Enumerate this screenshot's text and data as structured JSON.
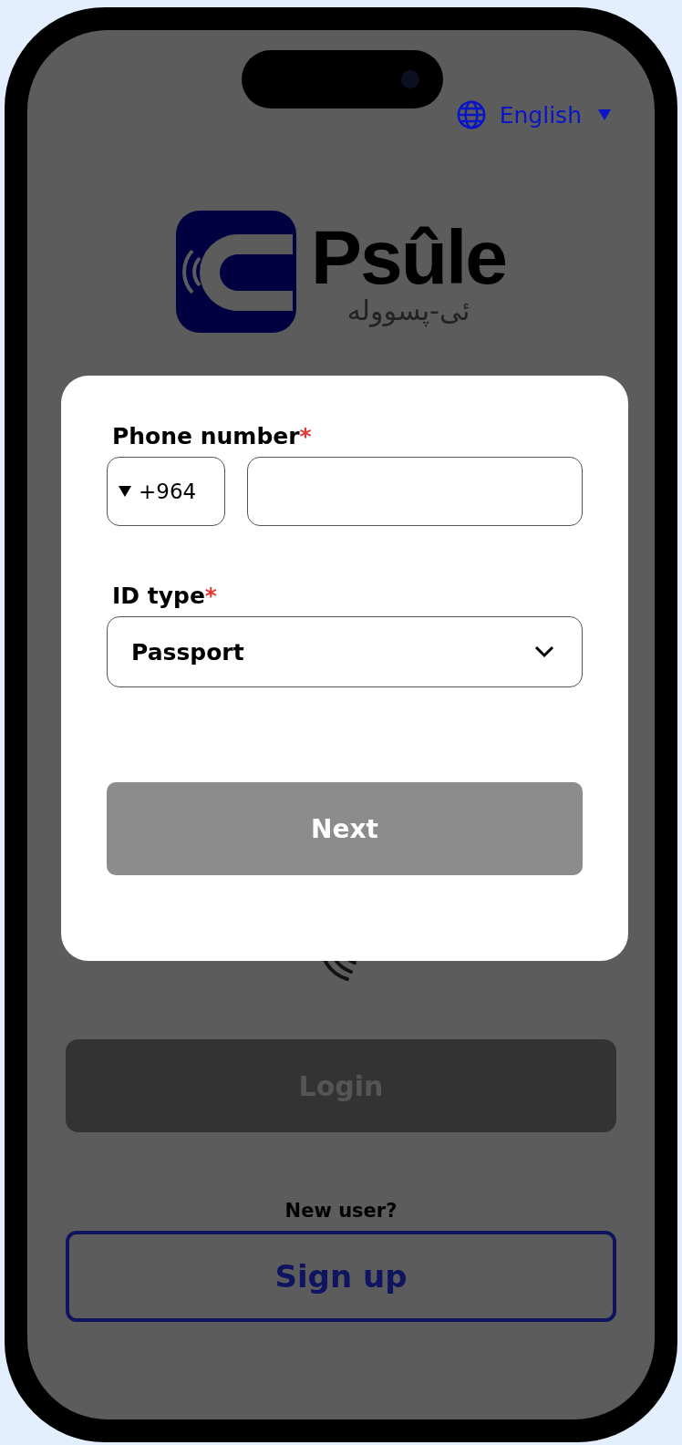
{
  "language": {
    "label": "English"
  },
  "logo": {
    "name": "Psûle",
    "subtitle": "ئی-پسوولە"
  },
  "modal": {
    "phone": {
      "label": "Phone number",
      "required_mark": "*",
      "country_code": "+964"
    },
    "id_type": {
      "label": "ID type",
      "required_mark": "*",
      "value": "Passport"
    },
    "next_button": {
      "label": "Next",
      "disabled": true
    }
  },
  "background": {
    "login_button": {
      "label": "Login",
      "disabled": true
    },
    "new_user": "New user?",
    "signup_button": {
      "label": "Sign up"
    }
  }
}
